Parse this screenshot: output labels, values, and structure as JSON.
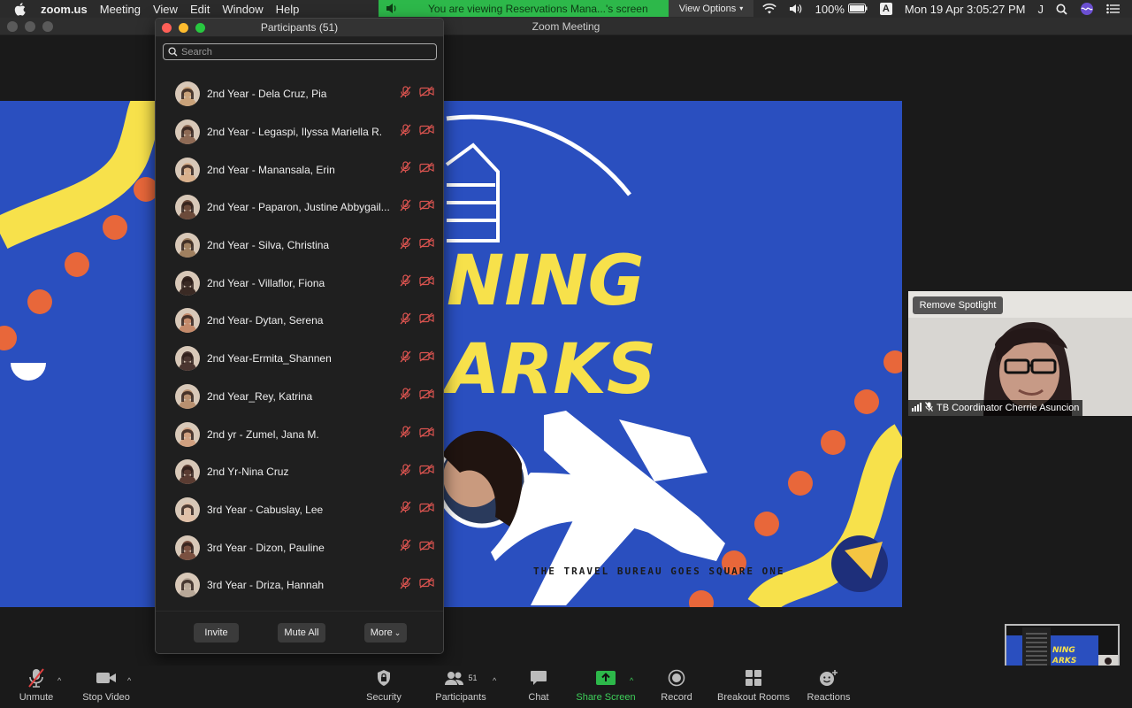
{
  "menubar": {
    "app": "zoom.us",
    "items": [
      "Meeting",
      "View",
      "Edit",
      "Window",
      "Help"
    ],
    "share_banner": "You are viewing Reservations Mana...'s screen",
    "view_options": "View Options",
    "battery": "100%",
    "input_source": "A",
    "datetime": "Mon 19 Apr  3:05:27 PM",
    "user_initial": "J"
  },
  "window": {
    "title": "Zoom Meeting"
  },
  "participants": {
    "title": "Participants (51)",
    "search_placeholder": "Search",
    "list": [
      {
        "name": "2nd Year - Dela Cruz, Pia",
        "color": "#c9a27a"
      },
      {
        "name": "2nd Year - Legaspi, Ilyssa Mariella R.",
        "color": "#8e6a55"
      },
      {
        "name": "2nd Year - Manansala, Erin",
        "color": "#d9b08c"
      },
      {
        "name": "2nd Year - Paparon, Justine Abbygail...",
        "color": "#6b4a3a"
      },
      {
        "name": "2nd Year - Silva, Christina",
        "color": "#a08060"
      },
      {
        "name": "2nd Year - Villaflor, Fiona",
        "color": "#3a2a24"
      },
      {
        "name": "2nd Year- Dytan, Serena",
        "color": "#c48a6a"
      },
      {
        "name": "2nd Year-Ermita_Shannen",
        "color": "#4a3530"
      },
      {
        "name": "2nd Year_Rey, Katrina",
        "color": "#b89070"
      },
      {
        "name": "2nd yr - Zumel, Jana M.",
        "color": "#d0a080"
      },
      {
        "name": "2nd Yr-Nina Cruz",
        "color": "#5a3c32"
      },
      {
        "name": "3rd Year - Cabuslay, Lee",
        "color": "#e0c0a8"
      },
      {
        "name": "3rd Year - Dizon, Pauline",
        "color": "#7a5040"
      },
      {
        "name": "3rd Year - Driza, Hannah",
        "color": "#b8a898"
      }
    ],
    "buttons": {
      "invite": "Invite",
      "mute_all": "Mute All",
      "more": "More"
    }
  },
  "slide": {
    "line1": "NING",
    "line2": "ARKS",
    "tagline": "THE TRAVEL BUREAU GOES SQUARE ONE"
  },
  "spotlight": {
    "remove_label": "Remove Spotlight",
    "name": "TB Coordinator Cherrie Asuncion"
  },
  "toolbar": {
    "unmute": "Unmute",
    "stop_video": "Stop Video",
    "security": "Security",
    "participants": "Participants",
    "participants_count": "51",
    "chat": "Chat",
    "share_screen": "Share Screen",
    "record": "Record",
    "breakout_rooms": "Breakout Rooms",
    "reactions": "Reactions"
  },
  "colors": {
    "slide_blue": "#2a4fbf",
    "slide_yellow": "#f7e14b",
    "slide_orange": "#e8673a",
    "share_green": "#2db84a",
    "muted_red": "#d9534f"
  }
}
